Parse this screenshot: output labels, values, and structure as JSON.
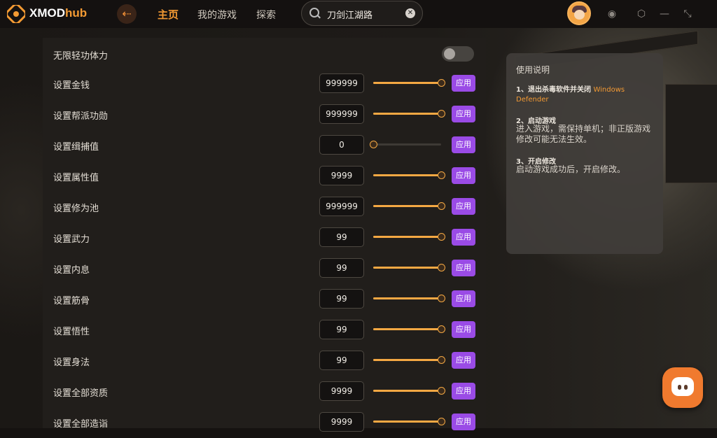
{
  "app": {
    "brand_left": "XMOD",
    "brand_right": "hub",
    "accent": "#f39a33",
    "apply_color": "#9a4be6"
  },
  "nav": {
    "items": [
      {
        "label": "主页",
        "active": true
      },
      {
        "label": "我的游戏",
        "active": false
      },
      {
        "label": "探索",
        "active": false
      }
    ]
  },
  "search": {
    "value": "刀剑江湖路",
    "icon": "search-icon"
  },
  "toggles": [
    {
      "label": "无限轻功体力",
      "on": false
    }
  ],
  "settings": [
    {
      "label": "设置金钱",
      "value": "999999",
      "level": 1.0,
      "apply": "应用"
    },
    {
      "label": "设置帮派功勋",
      "value": "999999",
      "level": 1.0,
      "apply": "应用"
    },
    {
      "label": "设置缉捕值",
      "value": "0",
      "level": 0.0,
      "apply": "应用"
    },
    {
      "label": "设置属性值",
      "value": "9999",
      "level": 1.0,
      "apply": "应用"
    },
    {
      "label": "设置修为池",
      "value": "999999",
      "level": 1.0,
      "apply": "应用"
    },
    {
      "label": "设置武力",
      "value": "99",
      "level": 1.0,
      "apply": "应用"
    },
    {
      "label": "设置内息",
      "value": "99",
      "level": 1.0,
      "apply": "应用"
    },
    {
      "label": "设置筋骨",
      "value": "99",
      "level": 1.0,
      "apply": "应用"
    },
    {
      "label": "设置悟性",
      "value": "99",
      "level": 1.0,
      "apply": "应用"
    },
    {
      "label": "设置身法",
      "value": "99",
      "level": 1.0,
      "apply": "应用"
    },
    {
      "label": "设置全部资质",
      "value": "9999",
      "level": 1.0,
      "apply": "应用"
    },
    {
      "label": "设置全部造诣",
      "value": "9999",
      "level": 1.0,
      "apply": "应用"
    }
  ],
  "instructions": {
    "title": "使用说明",
    "step1_head": "1、退出杀毒软件并关闭",
    "step1_highlight": "Windows Defender",
    "step2_head": "2、启动游戏",
    "step2_body": "进入游戏，需保持单机；非正版游戏修改可能无法生效。",
    "step3_head": "3、开启修改",
    "step3_body": "启动游戏成功后，开启修改。"
  }
}
